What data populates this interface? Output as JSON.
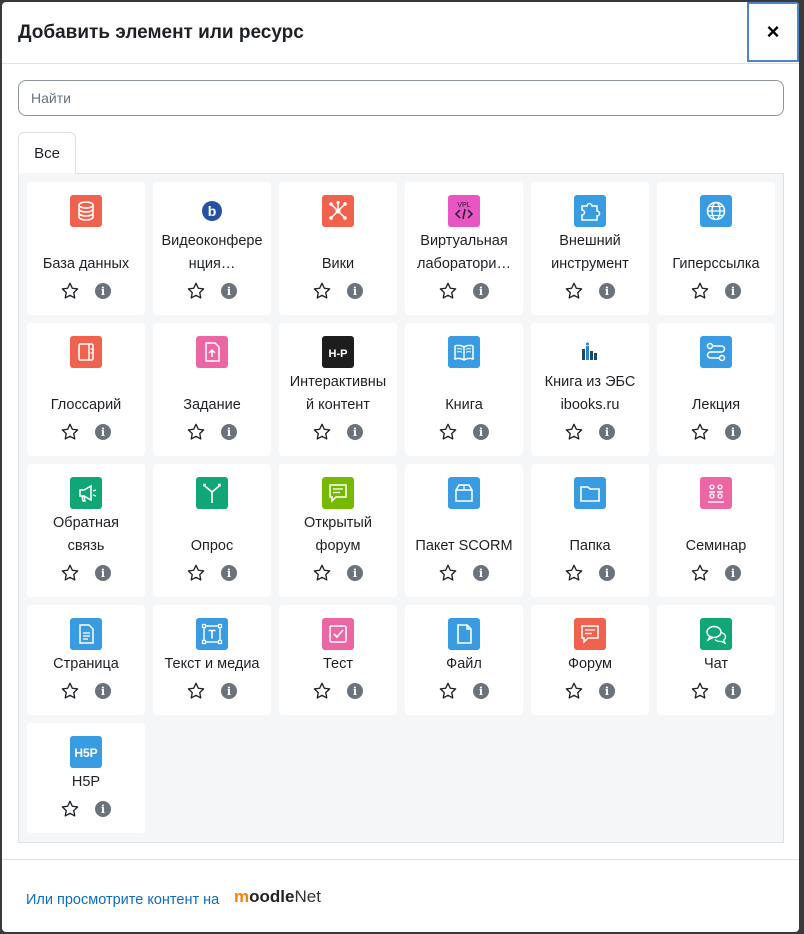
{
  "modal": {
    "title": "Добавить элемент или ресурс",
    "close_label": "×"
  },
  "search": {
    "placeholder": "Найти",
    "value": ""
  },
  "tabs": [
    {
      "label": "Все",
      "active": true
    }
  ],
  "items": [
    {
      "name_lines": [
        "База данных"
      ],
      "icon": "database-icon",
      "color": "#f0624d"
    },
    {
      "name_lines": [
        "Видеоконфере",
        "нция…"
      ],
      "icon": "bigbluebutton-icon",
      "color": "#2353a0"
    },
    {
      "name_lines": [
        "Вики"
      ],
      "icon": "wiki-icon",
      "color": "#f0624d"
    },
    {
      "name_lines": [
        "Виртуальная",
        "лаборатори…"
      ],
      "icon": "vpl-icon",
      "color": "#e856c4"
    },
    {
      "name_lines": [
        "Внешний",
        "инструмент"
      ],
      "icon": "puzzle-icon",
      "color": "#399be2"
    },
    {
      "name_lines": [
        "Гиперссылка"
      ],
      "icon": "globe-icon",
      "color": "#399be2"
    },
    {
      "name_lines": [
        "Глоссарий"
      ],
      "icon": "glossary-icon",
      "color": "#f0624d"
    },
    {
      "name_lines": [
        "Задание"
      ],
      "icon": "assignment-icon",
      "color": "#eb66a2"
    },
    {
      "name_lines": [
        "Интерактивны",
        "й контент"
      ],
      "icon": "h5p-dark-icon",
      "color": "#1d1d1d"
    },
    {
      "name_lines": [
        "Книга"
      ],
      "icon": "book-icon",
      "color": "#399be2"
    },
    {
      "name_lines": [
        "Книга из ЭБС",
        "ibooks.ru"
      ],
      "icon": "ibooks-icon",
      "color": "#1b4a6b"
    },
    {
      "name_lines": [
        "Лекция"
      ],
      "icon": "lesson-icon",
      "color": "#399be2"
    },
    {
      "name_lines": [
        "Обратная",
        "связь"
      ],
      "icon": "feedback-icon",
      "color": "#11a676"
    },
    {
      "name_lines": [
        "Опрос"
      ],
      "icon": "choice-icon",
      "color": "#11a676"
    },
    {
      "name_lines": [
        "Открытый",
        "форум"
      ],
      "icon": "open-forum-icon",
      "color": "#76b900"
    },
    {
      "name_lines": [
        "Пакет SCORM"
      ],
      "icon": "scorm-icon",
      "color": "#399be2"
    },
    {
      "name_lines": [
        "Папка"
      ],
      "icon": "folder-icon",
      "color": "#399be2"
    },
    {
      "name_lines": [
        "Семинар"
      ],
      "icon": "workshop-icon",
      "color": "#eb66a2"
    },
    {
      "name_lines": [
        "Страница"
      ],
      "icon": "page-icon",
      "color": "#399be2"
    },
    {
      "name_lines": [
        "Текст и медиа"
      ],
      "icon": "text-media-icon",
      "color": "#399be2"
    },
    {
      "name_lines": [
        "Тест"
      ],
      "icon": "quiz-icon",
      "color": "#eb66a2"
    },
    {
      "name_lines": [
        "Файл"
      ],
      "icon": "file-icon",
      "color": "#399be2"
    },
    {
      "name_lines": [
        "Форум"
      ],
      "icon": "forum-icon",
      "color": "#f0624d"
    },
    {
      "name_lines": [
        "Чат"
      ],
      "icon": "chat-icon",
      "color": "#11a676"
    },
    {
      "name_lines": [
        "H5P"
      ],
      "icon": "h5p-icon",
      "color": "#399be2"
    }
  ],
  "footer": {
    "link_text": "Или просмотрите контент на",
    "brand_m": "m",
    "brand_oodle": "oodle",
    "brand_net": "Net"
  },
  "icon_colors": {
    "star": "#1d2125",
    "info": "#6a737b",
    "link": "#0f6cbf",
    "focus": "#4e86c5"
  }
}
